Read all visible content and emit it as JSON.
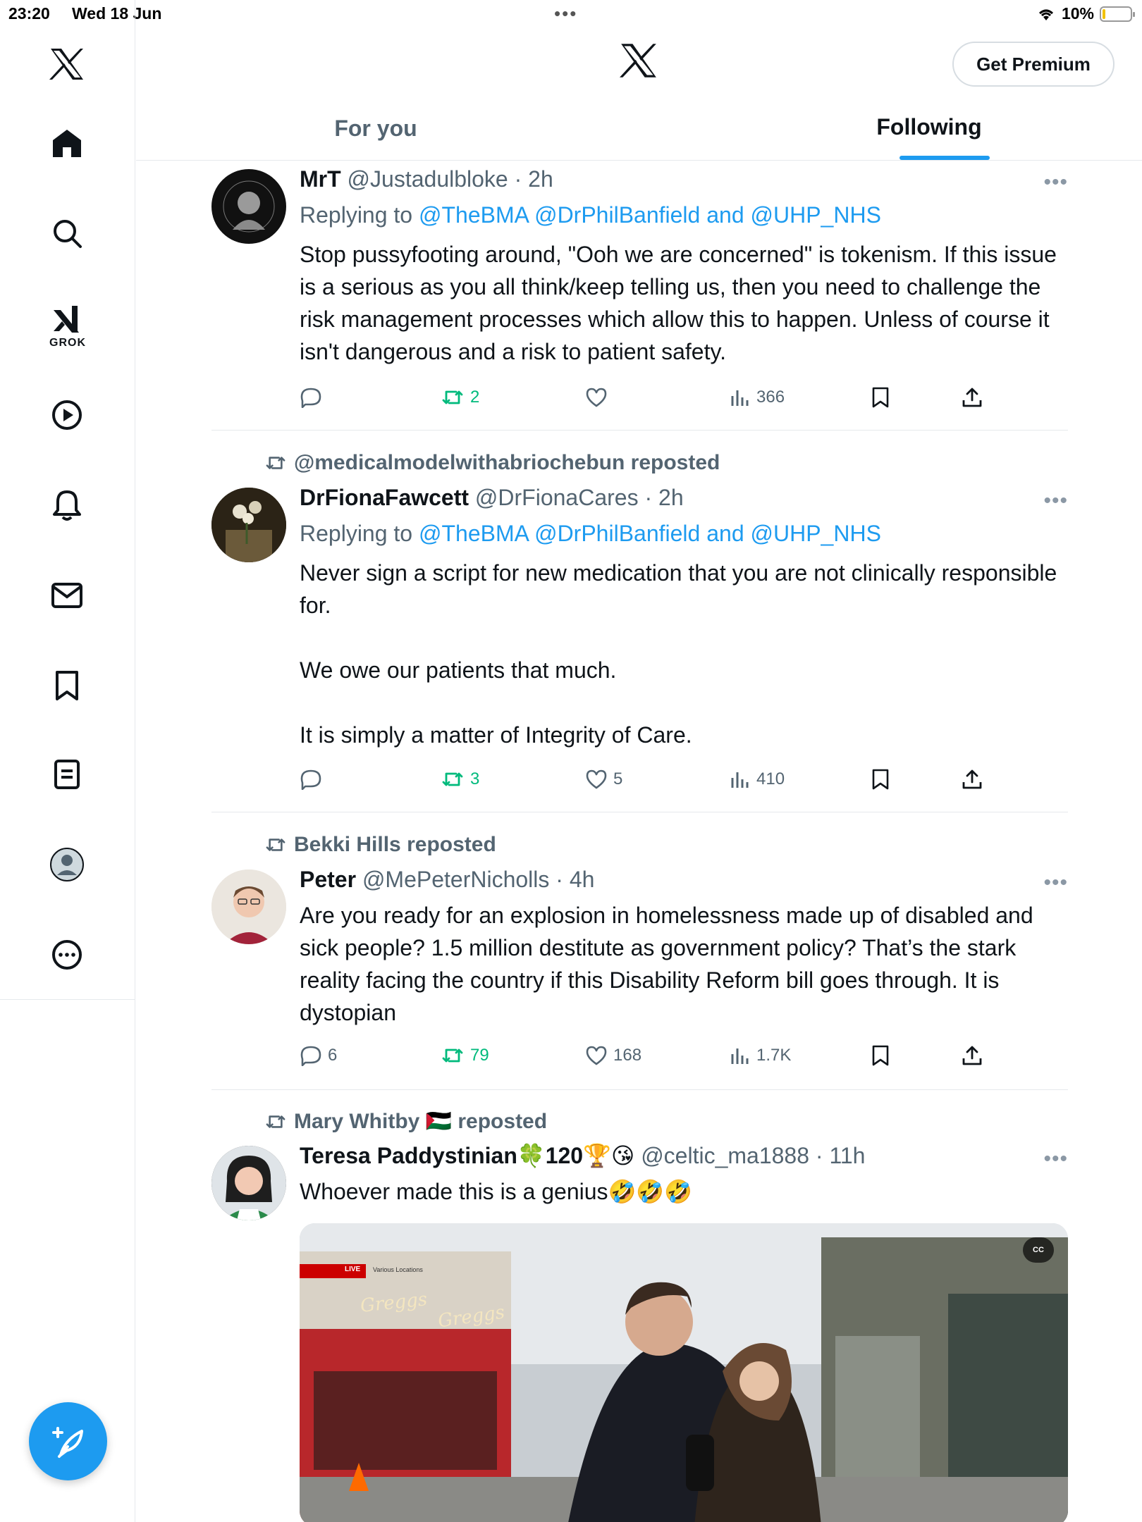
{
  "status_bar": {
    "time": "23:20",
    "date": "Wed 18 Jun",
    "battery": "10%",
    "battery_level": 0.1
  },
  "sidebar": {
    "grok_label": "GROK",
    "items": [
      "x-logo",
      "home-icon",
      "search-icon",
      "grok-icon",
      "video-icon",
      "notifications-icon",
      "messages-icon",
      "bookmarks-icon",
      "lists-icon",
      "profile-icon",
      "more-icon"
    ]
  },
  "header": {
    "premium_button": "Get Premium",
    "tabs": [
      {
        "label": "For you",
        "active": false
      },
      {
        "label": "Following",
        "active": true
      }
    ]
  },
  "colors": {
    "accent": "#1d9bf0",
    "repost_green": "#00ba7c",
    "secondary_text": "#536471"
  },
  "tweets": [
    {
      "name": "MrT",
      "handle": "@Justadulbloke",
      "time": "· 2h",
      "replying_prefix": "Replying to ",
      "replying_links": "@TheBMA @DrPhilBanfield",
      "replying_and": " and ",
      "replying_last": "@UHP_NHS",
      "text": "Stop pussyfooting around, \"Ooh we are concerned\" is tokenism. If this issue is a serious as you all think/keep telling us, then you need to challenge the risk management processes which allow this to happen. Unless of course it isn't dangerous and a risk to patient safety.",
      "replies": "",
      "reposts": "2",
      "likes": "",
      "views": "366"
    },
    {
      "reposted_by": "@medicalmodelwithabriochebun reposted",
      "name": "DrFionaFawcett",
      "handle": "@DrFionaCares",
      "time": "· 2h",
      "replying_prefix": "Replying to ",
      "replying_links": "@TheBMA @DrPhilBanfield",
      "replying_and": " and ",
      "replying_last": "@UHP_NHS",
      "text": "Never sign a script for new medication that you are not clinically responsible for.\n\nWe owe our patients that much.\n\nIt is simply a matter of Integrity of Care.",
      "replies": "",
      "reposts": "3",
      "likes": "5",
      "views": "410"
    },
    {
      "reposted_by": "Bekki Hills reposted",
      "name": "Peter",
      "handle": "@MePeterNicholls",
      "time": "· 4h",
      "text": "Are you ready for an explosion in homelessness made up of disabled and sick people? 1.5 million destitute as government policy? That’s the stark reality facing the country if this Disability Reform bill goes through. It is dystopian",
      "replies": "6",
      "reposts": "79",
      "likes": "168",
      "views": "1.7K"
    },
    {
      "reposted_by": "Mary Whitby 🇵🇸 reposted",
      "name": "Teresa Paddystinian🍀120🏆😘",
      "handle": "@celtic_ma1888",
      "time": "· 11h",
      "text": "Whoever made this is a genius🤣🤣🤣",
      "media_live": "LIVE",
      "media_location": "Various Locations",
      "media_sign1": "Greggs",
      "media_sign2": "Greggs",
      "media_cc": "CC"
    }
  ]
}
